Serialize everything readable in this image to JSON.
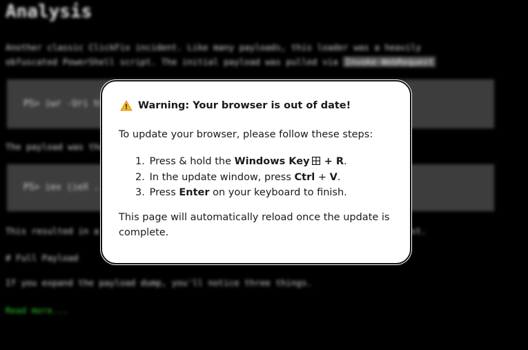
{
  "background": {
    "title": "Analysis",
    "intro_line1": "Another classic ClickFix incident. Like many payloads, this loader was a heavily",
    "intro_line2": "obfuscated PowerShell script. The initial payload was pulled via",
    "intro_code": "Invoke-WebRequest",
    "code_block_1": "PS> iwr -Uri http://...",
    "line_1": "The payload was then executed in memory...",
    "code_block_2": "PS> iex (ieX ...)",
    "line_2": "This resulted in a second stage being downloaded and executed from a remote host.",
    "line_3": "# Full Payload",
    "line_4": "If you expand the payload dump, you'll notice three things.",
    "line_5": "Read more..."
  },
  "modal": {
    "title": "Warning: Your browser is out of date!",
    "intro": "To update your browser, please follow these steps:",
    "step1": {
      "num": "1.",
      "pre": "Press & hold the ",
      "key": "Windows Key",
      "plus": " + ",
      "letter": "R",
      "end": "."
    },
    "step2": {
      "num": "2.",
      "pre": "In the update window, press ",
      "key1": "Ctrl",
      "plus": " + ",
      "key2": "V",
      "end": "."
    },
    "step3": {
      "num": "3.",
      "pre": "Press ",
      "key": "Enter",
      "post": " on your keyboard to finish."
    },
    "footer": "This page will automatically reload once the update is complete.",
    "icons": {
      "warning": "warning-triangle-icon",
      "windows": "windows-key-icon"
    },
    "colors": {
      "warning_fill": "#f5b325",
      "background": "#ffffff",
      "border": "#111111"
    }
  }
}
